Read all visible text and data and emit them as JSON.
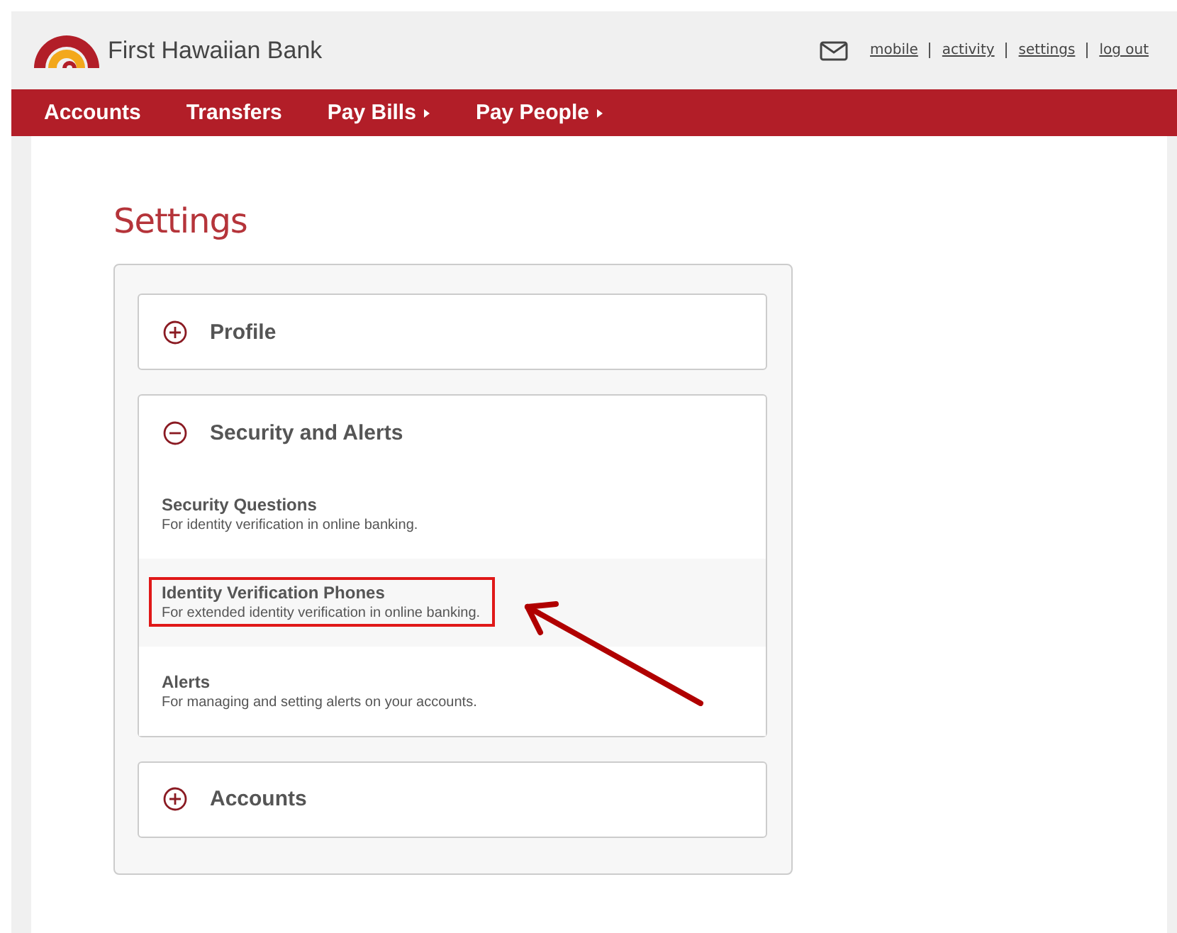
{
  "header": {
    "brand": "First Hawaiian Bank",
    "links": [
      "mobile",
      "activity",
      "settings",
      "log out"
    ]
  },
  "nav": [
    {
      "label": "Accounts",
      "has_menu": false
    },
    {
      "label": "Transfers",
      "has_menu": false
    },
    {
      "label": "Pay Bills",
      "has_menu": true
    },
    {
      "label": "Pay People",
      "has_menu": true
    }
  ],
  "page_title": "Settings",
  "sections": [
    {
      "title": "Profile",
      "expanded": false
    },
    {
      "title": "Security and Alerts",
      "expanded": true,
      "items": [
        {
          "title": "Security Questions",
          "description": "For identity verification in online banking.",
          "highlighted": false
        },
        {
          "title": "Identity Verification Phones",
          "description": "For extended identity verification in online banking.",
          "highlighted": true
        },
        {
          "title": "Alerts",
          "description": "For managing and setting alerts on your accounts.",
          "highlighted": false
        }
      ]
    },
    {
      "title": "Accounts",
      "expanded": false
    }
  ]
}
